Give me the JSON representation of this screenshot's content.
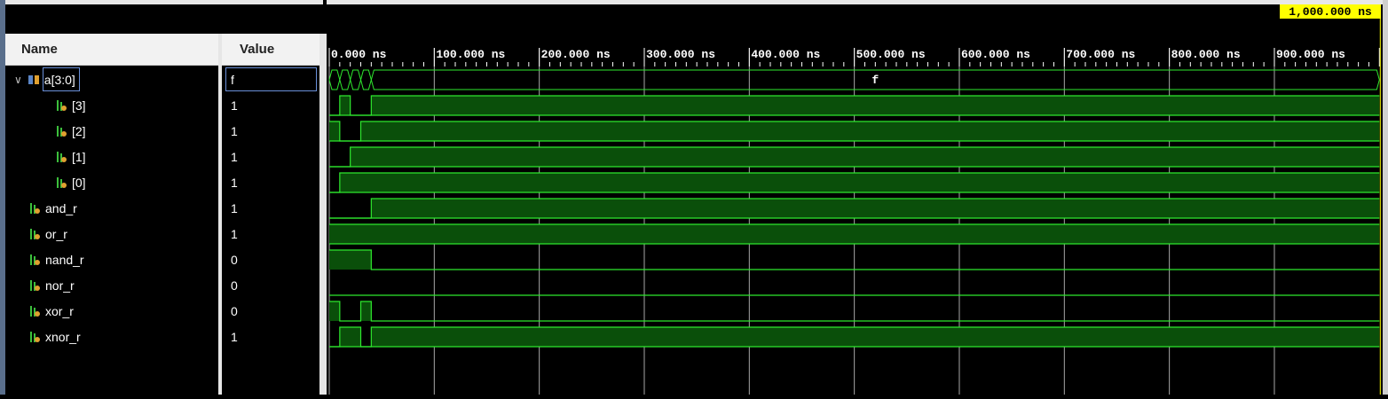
{
  "headers": {
    "name": "Name",
    "value": "Value"
  },
  "signals": [
    {
      "name": "a[3:0]",
      "value": "f",
      "kind": "bus",
      "expanded": true,
      "indent": 0
    },
    {
      "name": "[3]",
      "value": "1",
      "kind": "bit",
      "indent": 2
    },
    {
      "name": "[2]",
      "value": "1",
      "kind": "bit",
      "indent": 2
    },
    {
      "name": "[1]",
      "value": "1",
      "kind": "bit",
      "indent": 2
    },
    {
      "name": "[0]",
      "value": "1",
      "kind": "bit",
      "indent": 2
    },
    {
      "name": "and_r",
      "value": "1",
      "kind": "bit",
      "indent": 1
    },
    {
      "name": "or_r",
      "value": "1",
      "kind": "bit",
      "indent": 1
    },
    {
      "name": "nand_r",
      "value": "0",
      "kind": "bit",
      "indent": 1
    },
    {
      "name": "nor_r",
      "value": "0",
      "kind": "bit",
      "indent": 1
    },
    {
      "name": "xor_r",
      "value": "0",
      "kind": "bit",
      "indent": 1
    },
    {
      "name": "xnor_r",
      "value": "1",
      "kind": "bit",
      "indent": 1
    }
  ],
  "timeline": {
    "cursor_label": "1,000.000 ns",
    "cursor_time_ns": 1000,
    "range_ns": [
      0,
      1000
    ],
    "tick_labels": [
      "0.000 ns",
      "100.000 ns",
      "200.000 ns",
      "300.000 ns",
      "400.000 ns",
      "500.000 ns",
      "600.000 ns",
      "700.000 ns",
      "800.000 ns",
      "900.000 ns"
    ],
    "tick_times_ns": [
      0,
      100,
      200,
      300,
      400,
      500,
      600,
      700,
      800,
      900
    ]
  },
  "waveforms": {
    "bus_label": "f",
    "bus_transitions_ns": [
      0,
      10,
      20,
      30,
      40
    ],
    "bits": [
      {
        "signal": "[3]",
        "segments": [
          [
            0,
            0
          ],
          [
            10,
            1
          ],
          [
            20,
            0
          ],
          [
            40,
            1
          ]
        ]
      },
      {
        "signal": "[2]",
        "segments": [
          [
            0,
            1
          ],
          [
            10,
            0
          ],
          [
            30,
            1
          ]
        ]
      },
      {
        "signal": "[1]",
        "segments": [
          [
            0,
            0
          ],
          [
            20,
            1
          ]
        ]
      },
      {
        "signal": "[0]",
        "segments": [
          [
            0,
            0
          ],
          [
            10,
            1
          ]
        ]
      },
      {
        "signal": "and_r",
        "segments": [
          [
            0,
            0
          ],
          [
            40,
            1
          ]
        ]
      },
      {
        "signal": "or_r",
        "segments": [
          [
            0,
            1
          ]
        ]
      },
      {
        "signal": "nand_r",
        "segments": [
          [
            0,
            1
          ],
          [
            40,
            0
          ]
        ]
      },
      {
        "signal": "nor_r",
        "segments": [
          [
            0,
            0
          ]
        ]
      },
      {
        "signal": "xor_r",
        "segments": [
          [
            0,
            1
          ],
          [
            10,
            0
          ],
          [
            30,
            1
          ],
          [
            40,
            0
          ]
        ]
      },
      {
        "signal": "xnor_r",
        "segments": [
          [
            0,
            0
          ],
          [
            10,
            1
          ],
          [
            30,
            0
          ],
          [
            40,
            1
          ]
        ]
      }
    ]
  },
  "colors": {
    "wave_line": "#2ee82e",
    "wave_fill": "#0a4f0a",
    "grid": "#a8a8a8",
    "cursor_label_bg": "#ffff00",
    "ruler_text": "#ffffff"
  }
}
